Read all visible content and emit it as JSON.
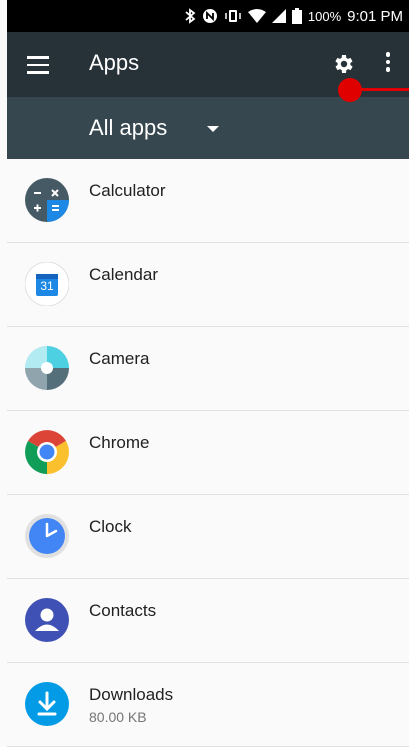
{
  "status": {
    "battery": "100%",
    "time": "9:01 PM"
  },
  "appbar": {
    "title": "Apps"
  },
  "spinner": {
    "selected": "All apps"
  },
  "apps": [
    {
      "name": "Calculator",
      "icon": "calculator-icon"
    },
    {
      "name": "Calendar",
      "icon": "calendar-icon",
      "badge": "31"
    },
    {
      "name": "Camera",
      "icon": "camera-icon"
    },
    {
      "name": "Chrome",
      "icon": "chrome-icon"
    },
    {
      "name": "Clock",
      "icon": "clock-icon"
    },
    {
      "name": "Contacts",
      "icon": "contacts-icon"
    },
    {
      "name": "Downloads",
      "icon": "downloads-icon",
      "size": "80.00 KB"
    }
  ],
  "colors": {
    "appbar": "#263238",
    "spinner": "#37474f",
    "marker": "#e00000"
  }
}
